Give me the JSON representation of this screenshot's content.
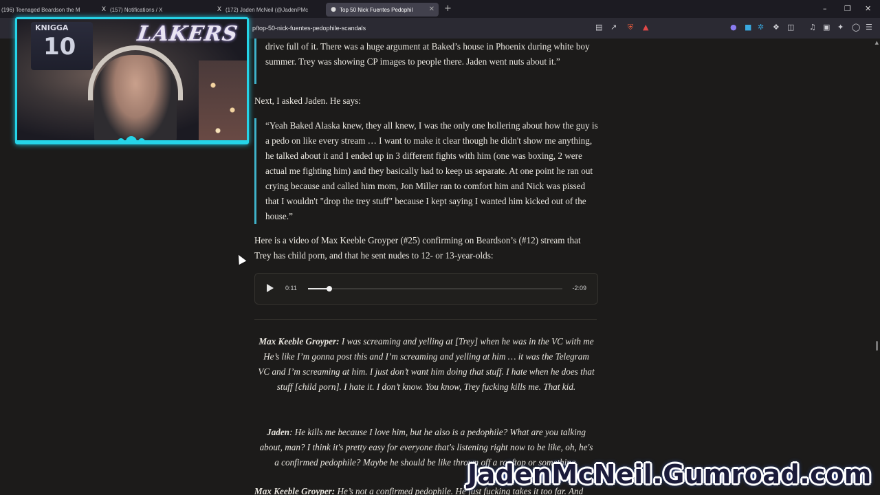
{
  "browser": {
    "tabs": [
      {
        "icon": "",
        "title": "(196) Teenaged Beardson the M",
        "active": false
      },
      {
        "icon": "X",
        "title": "(157) Notifications / X",
        "active": false
      },
      {
        "icon": "X",
        "title": "(172) Jaden McNeil (@JadenPMc",
        "active": false
      },
      {
        "icon": "",
        "title": "Top 50 Nick Fuentes Pedophil",
        "active": true
      }
    ],
    "new_tab": "+",
    "url": "p/top-50-nick-fuentes-pedophile-scandals"
  },
  "article": {
    "p1": "drive full of it. There was a huge argument at Baked’s house in Phoenix during white boy summer. Trey was showing CP images to people there. Jaden went nuts about it.”",
    "p2": "Next, I asked Jaden. He says:",
    "bq": "“Yeah Baked Alaska knew, they all knew, I was the only one hollering about how the guy is a pedo on like every stream … I want to make it clear though he didn't show me anything, he talked about it and I ended up in 3 different fights with him (one was boxing, 2 were actual me fighting him) and they basically had to keep us separate. At one point he ran out crying because and called him mom, Jon Miller ran to comfort him and Nick was pissed that I wouldn't \"drop the trey stuff\" because I kept saying I wanted him kicked out of the house.”",
    "p3": "Here is a video of Max Keeble Groyper (#25) confirming on Beardson’s (#12) stream that Trey has child porn, and that he sent nudes to 12- or 13-year-olds:",
    "audio": {
      "current": "0:11",
      "remaining": "-2:09",
      "progress": 0.085
    },
    "q1_speaker": "Max Keeble Groyper:",
    "q1_text": " I was screaming and yelling at [Trey] when he was in the VC with me He’s like I’m gonna post this and I’m screaming and yelling at him … it was the Telegram VC and I’m screaming at him. I just don’t want him doing that stuff. I hate when he does that stuff [child porn]. I hate it. I don’t know. You know, Trey fucking kills me. That kid.",
    "q2_speaker": "Jaden",
    "q2_text": ": He kills me because I love him, but he also is a pedophile? What are you talking about, man? I think it's pretty easy for everyone that's listening right now to be like, oh, he's a confirmed pedophile? Maybe he should be like thrown off a rooftop or something.",
    "q3_speaker": "Max Keeble Groyper:",
    "q3_text": " He’s not a confirmed pedophile. He just fucking takes it too far. And"
  },
  "webcam": {
    "banner": "LAKERS",
    "jersey_name": "KNIGGA",
    "jersey_number": "10"
  },
  "watermark": "JadenMcNeil.Gumroad.com"
}
